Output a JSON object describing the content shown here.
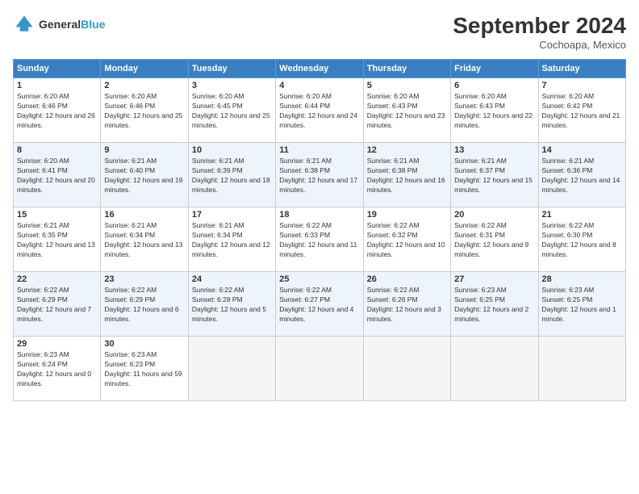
{
  "header": {
    "logo_line1": "General",
    "logo_line2": "Blue",
    "month": "September 2024",
    "location": "Cochoapa, Mexico"
  },
  "weekdays": [
    "Sunday",
    "Monday",
    "Tuesday",
    "Wednesday",
    "Thursday",
    "Friday",
    "Saturday"
  ],
  "weeks": [
    [
      {
        "day": "1",
        "sunrise": "Sunrise: 6:20 AM",
        "sunset": "Sunset: 6:46 PM",
        "daylight": "Daylight: 12 hours and 26 minutes."
      },
      {
        "day": "2",
        "sunrise": "Sunrise: 6:20 AM",
        "sunset": "Sunset: 6:46 PM",
        "daylight": "Daylight: 12 hours and 25 minutes."
      },
      {
        "day": "3",
        "sunrise": "Sunrise: 6:20 AM",
        "sunset": "Sunset: 6:45 PM",
        "daylight": "Daylight: 12 hours and 25 minutes."
      },
      {
        "day": "4",
        "sunrise": "Sunrise: 6:20 AM",
        "sunset": "Sunset: 6:44 PM",
        "daylight": "Daylight: 12 hours and 24 minutes."
      },
      {
        "day": "5",
        "sunrise": "Sunrise: 6:20 AM",
        "sunset": "Sunset: 6:43 PM",
        "daylight": "Daylight: 12 hours and 23 minutes."
      },
      {
        "day": "6",
        "sunrise": "Sunrise: 6:20 AM",
        "sunset": "Sunset: 6:43 PM",
        "daylight": "Daylight: 12 hours and 22 minutes."
      },
      {
        "day": "7",
        "sunrise": "Sunrise: 6:20 AM",
        "sunset": "Sunset: 6:42 PM",
        "daylight": "Daylight: 12 hours and 21 minutes."
      }
    ],
    [
      {
        "day": "8",
        "sunrise": "Sunrise: 6:20 AM",
        "sunset": "Sunset: 6:41 PM",
        "daylight": "Daylight: 12 hours and 20 minutes."
      },
      {
        "day": "9",
        "sunrise": "Sunrise: 6:21 AM",
        "sunset": "Sunset: 6:40 PM",
        "daylight": "Daylight: 12 hours and 19 minutes."
      },
      {
        "day": "10",
        "sunrise": "Sunrise: 6:21 AM",
        "sunset": "Sunset: 6:39 PM",
        "daylight": "Daylight: 12 hours and 18 minutes."
      },
      {
        "day": "11",
        "sunrise": "Sunrise: 6:21 AM",
        "sunset": "Sunset: 6:38 PM",
        "daylight": "Daylight: 12 hours and 17 minutes."
      },
      {
        "day": "12",
        "sunrise": "Sunrise: 6:21 AM",
        "sunset": "Sunset: 6:38 PM",
        "daylight": "Daylight: 12 hours and 16 minutes."
      },
      {
        "day": "13",
        "sunrise": "Sunrise: 6:21 AM",
        "sunset": "Sunset: 6:37 PM",
        "daylight": "Daylight: 12 hours and 15 minutes."
      },
      {
        "day": "14",
        "sunrise": "Sunrise: 6:21 AM",
        "sunset": "Sunset: 6:36 PM",
        "daylight": "Daylight: 12 hours and 14 minutes."
      }
    ],
    [
      {
        "day": "15",
        "sunrise": "Sunrise: 6:21 AM",
        "sunset": "Sunset: 6:35 PM",
        "daylight": "Daylight: 12 hours and 13 minutes."
      },
      {
        "day": "16",
        "sunrise": "Sunrise: 6:21 AM",
        "sunset": "Sunset: 6:34 PM",
        "daylight": "Daylight: 12 hours and 13 minutes."
      },
      {
        "day": "17",
        "sunrise": "Sunrise: 6:21 AM",
        "sunset": "Sunset: 6:34 PM",
        "daylight": "Daylight: 12 hours and 12 minutes."
      },
      {
        "day": "18",
        "sunrise": "Sunrise: 6:22 AM",
        "sunset": "Sunset: 6:33 PM",
        "daylight": "Daylight: 12 hours and 11 minutes."
      },
      {
        "day": "19",
        "sunrise": "Sunrise: 6:22 AM",
        "sunset": "Sunset: 6:32 PM",
        "daylight": "Daylight: 12 hours and 10 minutes."
      },
      {
        "day": "20",
        "sunrise": "Sunrise: 6:22 AM",
        "sunset": "Sunset: 6:31 PM",
        "daylight": "Daylight: 12 hours and 9 minutes."
      },
      {
        "day": "21",
        "sunrise": "Sunrise: 6:22 AM",
        "sunset": "Sunset: 6:30 PM",
        "daylight": "Daylight: 12 hours and 8 minutes."
      }
    ],
    [
      {
        "day": "22",
        "sunrise": "Sunrise: 6:22 AM",
        "sunset": "Sunset: 6:29 PM",
        "daylight": "Daylight: 12 hours and 7 minutes."
      },
      {
        "day": "23",
        "sunrise": "Sunrise: 6:22 AM",
        "sunset": "Sunset: 6:29 PM",
        "daylight": "Daylight: 12 hours and 6 minutes."
      },
      {
        "day": "24",
        "sunrise": "Sunrise: 6:22 AM",
        "sunset": "Sunset: 6:28 PM",
        "daylight": "Daylight: 12 hours and 5 minutes."
      },
      {
        "day": "25",
        "sunrise": "Sunrise: 6:22 AM",
        "sunset": "Sunset: 6:27 PM",
        "daylight": "Daylight: 12 hours and 4 minutes."
      },
      {
        "day": "26",
        "sunrise": "Sunrise: 6:22 AM",
        "sunset": "Sunset: 6:26 PM",
        "daylight": "Daylight: 12 hours and 3 minutes."
      },
      {
        "day": "27",
        "sunrise": "Sunrise: 6:23 AM",
        "sunset": "Sunset: 6:25 PM",
        "daylight": "Daylight: 12 hours and 2 minutes."
      },
      {
        "day": "28",
        "sunrise": "Sunrise: 6:23 AM",
        "sunset": "Sunset: 6:25 PM",
        "daylight": "Daylight: 12 hours and 1 minute."
      }
    ],
    [
      {
        "day": "29",
        "sunrise": "Sunrise: 6:23 AM",
        "sunset": "Sunset: 6:24 PM",
        "daylight": "Daylight: 12 hours and 0 minutes."
      },
      {
        "day": "30",
        "sunrise": "Sunrise: 6:23 AM",
        "sunset": "Sunset: 6:23 PM",
        "daylight": "Daylight: 11 hours and 59 minutes."
      },
      null,
      null,
      null,
      null,
      null
    ]
  ]
}
